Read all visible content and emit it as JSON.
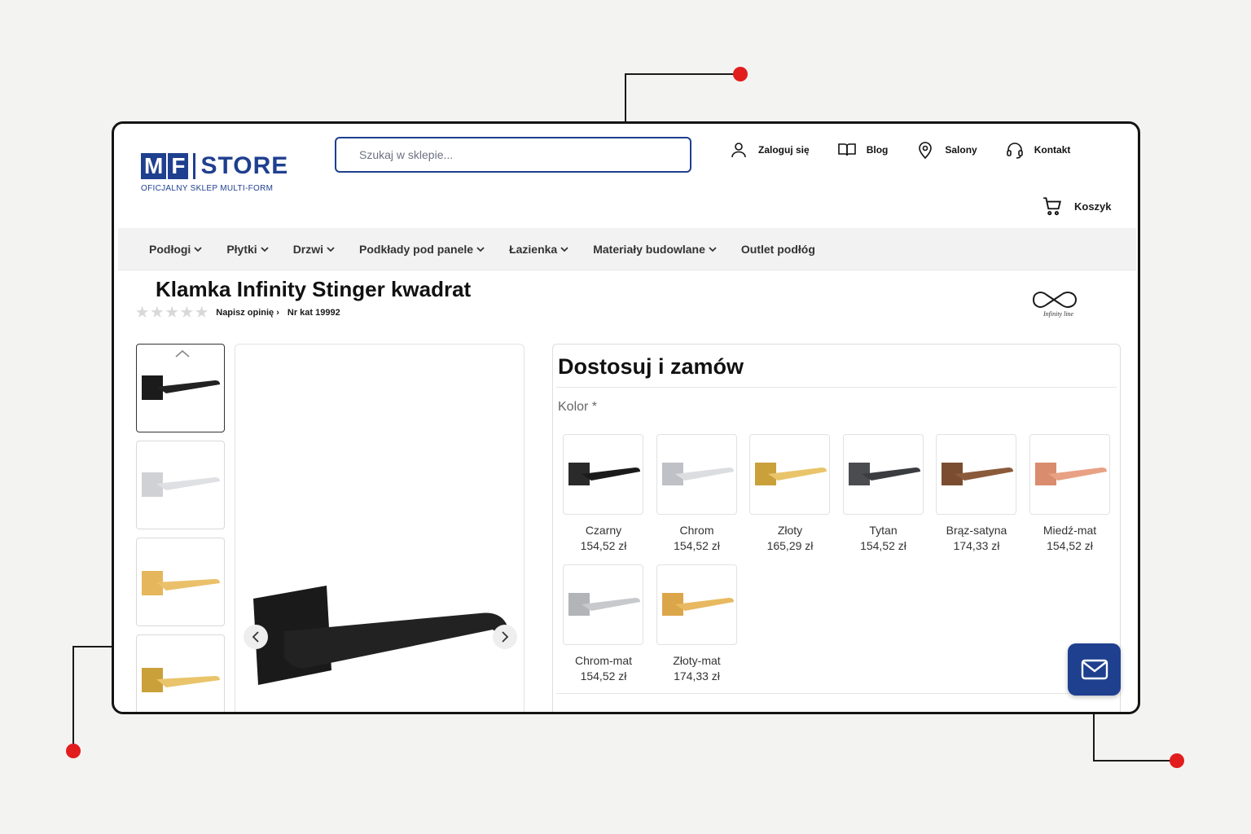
{
  "header": {
    "logo_letters": [
      "M",
      "F"
    ],
    "logo_text": "STORE",
    "logo_subtitle": "OFICJALNY SKLEP MULTI-FORM",
    "search_placeholder": "Szukaj w sklepie...",
    "links": [
      {
        "label": "Zaloguj się",
        "icon": "user-icon"
      },
      {
        "label": "Blog",
        "icon": "book-icon"
      },
      {
        "label": "Salony",
        "icon": "location-pin-icon"
      },
      {
        "label": "Kontakt",
        "icon": "headset-icon"
      }
    ],
    "cart_label": "Koszyk"
  },
  "nav": {
    "items": [
      {
        "label": "Podłogi",
        "dropdown": true
      },
      {
        "label": "Płytki",
        "dropdown": true
      },
      {
        "label": "Drzwi",
        "dropdown": true
      },
      {
        "label": "Podkłady pod panele",
        "dropdown": true
      },
      {
        "label": "Łazienka",
        "dropdown": true
      },
      {
        "label": "Materiały budowlane",
        "dropdown": true
      },
      {
        "label": "Outlet podłóg",
        "dropdown": false
      }
    ]
  },
  "product": {
    "title": "Klamka Infinity Stinger kwadrat",
    "rating": 0,
    "review_link": "Napisz opinię",
    "catalog_number": "Nr kat 19992",
    "brand_logo_text": "Infinity line"
  },
  "gallery": {
    "thumbnails": [
      "black",
      "chrome",
      "gold-matte",
      "gold"
    ],
    "active_thumbnail": 0,
    "prev_label": "‹",
    "next_label": "›"
  },
  "customize": {
    "title": "Dostosuj i zamów",
    "color_label": "Kolor *",
    "options": [
      {
        "name": "Czarny",
        "price": "154,52 zł",
        "color": "#1b1b1b",
        "rose": "#2a2a2a"
      },
      {
        "name": "Chrom",
        "price": "154,52 zł",
        "color": "#dcdde0",
        "rose": "#bfc1c6"
      },
      {
        "name": "Złoty",
        "price": "165,29 zł",
        "color": "#e9c46a",
        "rose": "#c9a03a"
      },
      {
        "name": "Tytan",
        "price": "154,52 zł",
        "color": "#3a3c40",
        "rose": "#4a4c50"
      },
      {
        "name": "Brąz-satyna",
        "price": "174,33 zł",
        "color": "#8a5a3a",
        "rose": "#7a4d30"
      },
      {
        "name": "Miedź-mat",
        "price": "154,52 zł",
        "color": "#e8a184",
        "rose": "#d98c6e"
      },
      {
        "name": "Chrom-mat",
        "price": "154,52 zł",
        "color": "#c8c9cc",
        "rose": "#b3b4b8"
      },
      {
        "name": "Złoty-mat",
        "price": "174,33 zł",
        "color": "#e8b960",
        "rose": "#dba64a"
      }
    ]
  },
  "floating": {
    "icon": "mail-icon"
  },
  "colors": {
    "brand": "#1f3f8f",
    "accent_dot": "#e11d1d"
  }
}
